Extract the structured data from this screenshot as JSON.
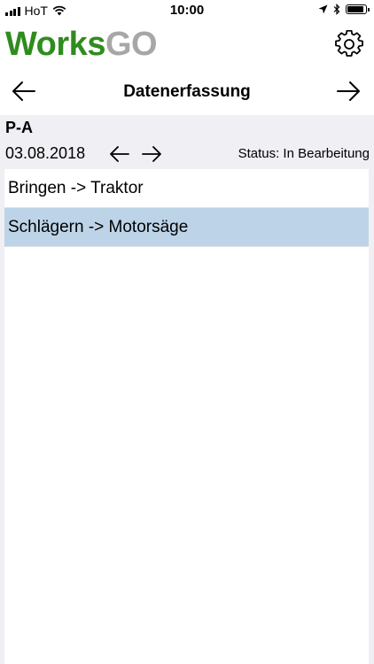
{
  "status_bar": {
    "carrier": "HoT",
    "time": "10:00",
    "battery_level": 0.9
  },
  "app": {
    "logo_part1": "Works",
    "logo_part2": "GO",
    "colors": {
      "logo_green": "#2f8c1e",
      "logo_gray": "#a7a7a7",
      "selected_row": "#bdd4e8"
    }
  },
  "nav": {
    "title": "Datenerfassung",
    "back_icon": "arrow-left-icon",
    "forward_icon": "arrow-right-icon"
  },
  "main": {
    "project": "P-A",
    "date": "03.08.2018",
    "status": "Status: In Bearbeitung",
    "items": [
      {
        "label": "Bringen -> Traktor",
        "selected": false
      },
      {
        "label": "Schlägern -> Motorsäge",
        "selected": true
      }
    ]
  }
}
